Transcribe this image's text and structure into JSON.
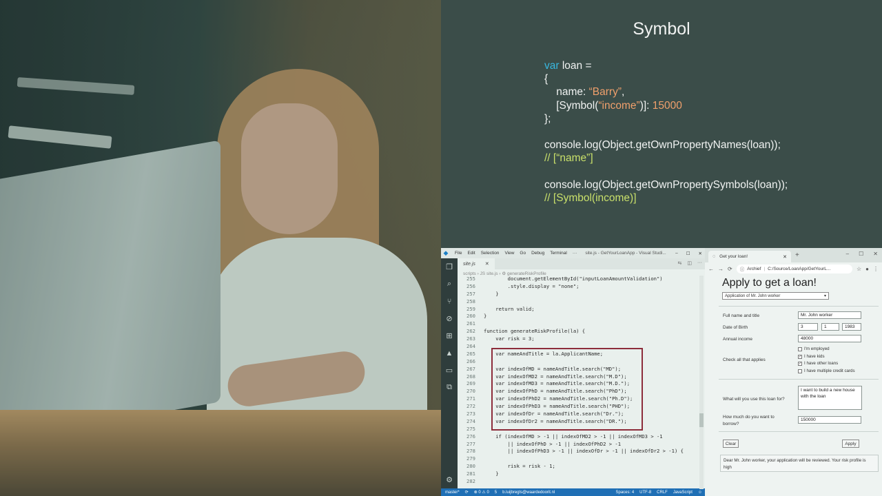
{
  "slide": {
    "title": "Symbol",
    "code": {
      "l1_kw": "var",
      "l1_rest": " loan =",
      "l2": "{",
      "l3_pre": "    name: ",
      "l3_str": "“Barry”",
      "l3_post": ",",
      "l4_pre": "    [Symbol(",
      "l4_str": "“income”",
      "l4_mid": ")]: ",
      "l4_num": "15000",
      "l5": "};",
      "l7": "console.log(Object.getOwnPropertyNames(loan));",
      "l8": "// [“name”]",
      "l10": "console.log(Object.getOwnPropertySymbols(loan));",
      "l11": "// [Symbol(income)]"
    }
  },
  "vscode": {
    "menu": [
      "File",
      "Edit",
      "Selection",
      "View",
      "Go",
      "Debug",
      "Terminal",
      "···"
    ],
    "window_title": "site.js - GetYourLoanApp - Visual Studi...",
    "tab_label": "site.js",
    "breadcrumb": "scripts › JS site.js › ⚙ generateRiskProfile",
    "lines": [
      {
        "no": "255",
        "text": "        document.getElementById(\"inputLoanAmountValidation\")"
      },
      {
        "no": "256",
        "text": "        .style.display = \"none\";"
      },
      {
        "no": "257",
        "text": "    }"
      },
      {
        "no": "258",
        "text": ""
      },
      {
        "no": "259",
        "text": "    return valid;"
      },
      {
        "no": "260",
        "text": "}"
      },
      {
        "no": "261",
        "text": ""
      },
      {
        "no": "262",
        "text": "function generateRiskProfile(la) {"
      },
      {
        "no": "263",
        "text": "    var risk = 3;"
      },
      {
        "no": "264",
        "text": ""
      },
      {
        "no": "265",
        "text": "    var nameAndTitle = la.ApplicantName;"
      },
      {
        "no": "266",
        "text": ""
      },
      {
        "no": "267",
        "text": "    var indexOfMD = nameAndTitle.search(\"MD\");"
      },
      {
        "no": "268",
        "text": "    var indexOfMD2 = nameAndTitle.search(\"M.D\");"
      },
      {
        "no": "269",
        "text": "    var indexOfMD3 = nameAndTitle.search(\"M.D.\");"
      },
      {
        "no": "270",
        "text": "    var indexOfPhD = nameAndTitle.search(\"PhD\");"
      },
      {
        "no": "271",
        "text": "    var indexOfPhD2 = nameAndTitle.search(\"Ph.D\");"
      },
      {
        "no": "272",
        "text": "    var indexOfPhD3 = nameAndTitle.search(\"PHD\");"
      },
      {
        "no": "273",
        "text": "    var indexOfDr = nameAndTitle.search(\"Dr.\");"
      },
      {
        "no": "274",
        "text": "    var indexOfDr2 = nameAndTitle.search(\"DR.\");"
      },
      {
        "no": "275",
        "text": ""
      },
      {
        "no": "276",
        "text": "    if (indexOfMD > -1 || indexOfMD2 > -1 || indexOfMD3 > -1"
      },
      {
        "no": "277",
        "text": "        || indexOfPhD > -1 || indexOfPhD2 > -1"
      },
      {
        "no": "278",
        "text": "        || indexOfPhD3 > -1 || indexOfDr > -1 || indexOfDr2 > -1) {"
      },
      {
        "no": "279",
        "text": ""
      },
      {
        "no": "280",
        "text": "        risk = risk - 1;"
      },
      {
        "no": "281",
        "text": "    }"
      },
      {
        "no": "282",
        "text": ""
      }
    ],
    "status": {
      "branch": "master*",
      "sync": "⟳",
      "problems": "⊗ 0 ⚠ 0",
      "users": "5",
      "user": "b.luijbregts@waardedoorit.nl",
      "spaces": "Spaces: 4",
      "encoding": "UTF-8",
      "eol": "CRLF",
      "language": "JavaScript"
    }
  },
  "browser": {
    "tab_title": "Get your loan!",
    "url_site": "Archief",
    "url_path": "C:/Source/LoanApp/GetYourL...",
    "form": {
      "title": "Apply to get a loan!",
      "select_value": "Application of Mr. John worker",
      "full_name_label": "Full name and title",
      "full_name_value": "Mr. John worker",
      "dob_label": "Date of Birth",
      "dob_day": "3",
      "dob_month": "1",
      "dob_year": "1983",
      "income_label": "Annual income",
      "income_value": "48000",
      "check_label": "Check all that applies",
      "checks": [
        {
          "label": "I'm employed",
          "checked": false
        },
        {
          "label": "I have kids",
          "checked": true
        },
        {
          "label": "I have other loans",
          "checked": true
        },
        {
          "label": "I have multiple credit cards",
          "checked": false
        }
      ],
      "purpose_label": "What will you use this loan for?",
      "purpose_value": "I want to build a new house with the loan",
      "amount_label": "How much do you want to borrow?",
      "amount_value": "150000",
      "clear_label": "Clear",
      "apply_label": "Apply",
      "result_text": "Dear Mr. John worker, your application will be reviewed. Your risk profile is high"
    }
  }
}
